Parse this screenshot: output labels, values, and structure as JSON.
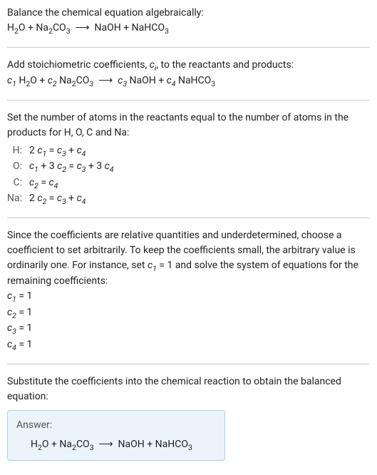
{
  "title": "Balance the chemical equation algebraically:",
  "equation_html": "H<sub>2</sub>O + Na<sub>2</sub>CO<sub>3</sub> &nbsp;⟶&nbsp; NaOH + NaHCO<sub>3</sub>",
  "step_coeffs_intro": "Add stoichiometric coefficients, <span class='ital'>c<sub>i</sub></span>, to the reactants and products:",
  "step_coeffs_eq": "<span class='ital'>c<sub>1</sub></span> H<sub>2</sub>O + <span class='ital'>c<sub>2</sub></span> Na<sub>2</sub>CO<sub>3</sub> &nbsp;⟶&nbsp; <span class='ital'>c<sub>3</sub></span> NaOH + <span class='ital'>c<sub>4</sub></span> NaHCO<sub>3</sub>",
  "step_atoms_intro": "Set the number of atoms in the reactants equal to the number of atoms in the products for H, O, C and Na:",
  "atom_eqs": [
    {
      "label": "H:",
      "rhs": "2 <span class='ital'>c<sub>1</sub></span> = <span class='ital'>c<sub>3</sub></span> + <span class='ital'>c<sub>4</sub></span>"
    },
    {
      "label": "O:",
      "rhs": "<span class='ital'>c<sub>1</sub></span> + 3 <span class='ital'>c<sub>2</sub></span> = <span class='ital'>c<sub>3</sub></span> + 3 <span class='ital'>c<sub>4</sub></span>"
    },
    {
      "label": "C:",
      "rhs": "<span class='ital'>c<sub>2</sub></span> = <span class='ital'>c<sub>4</sub></span>"
    },
    {
      "label": "Na:",
      "rhs": "2 <span class='ital'>c<sub>2</sub></span> = <span class='ital'>c<sub>3</sub></span> + <span class='ital'>c<sub>4</sub></span>"
    }
  ],
  "step_solve_intro": "Since the coefficients are relative quantities and underdetermined, choose a coefficient to set arbitrarily. To keep the coefficients small, the arbitrary value is ordinarily one. For instance, set <span class='ital'>c<sub>1</sub></span> = 1 and solve the system of equations for the remaining coefficients:",
  "solutions": [
    "<span class='ital'>c<sub>1</sub></span> = 1",
    "<span class='ital'>c<sub>2</sub></span> = 1",
    "<span class='ital'>c<sub>3</sub></span> = 1",
    "<span class='ital'>c<sub>4</sub></span> = 1"
  ],
  "step_subst": "Substitute the coefficients into the chemical reaction to obtain the balanced equation:",
  "answer_label": "Answer:",
  "answer_eq_html": "H<sub>2</sub>O + Na<sub>2</sub>CO<sub>3</sub> &nbsp;⟶&nbsp; NaOH + NaHCO<sub>3</sub>"
}
